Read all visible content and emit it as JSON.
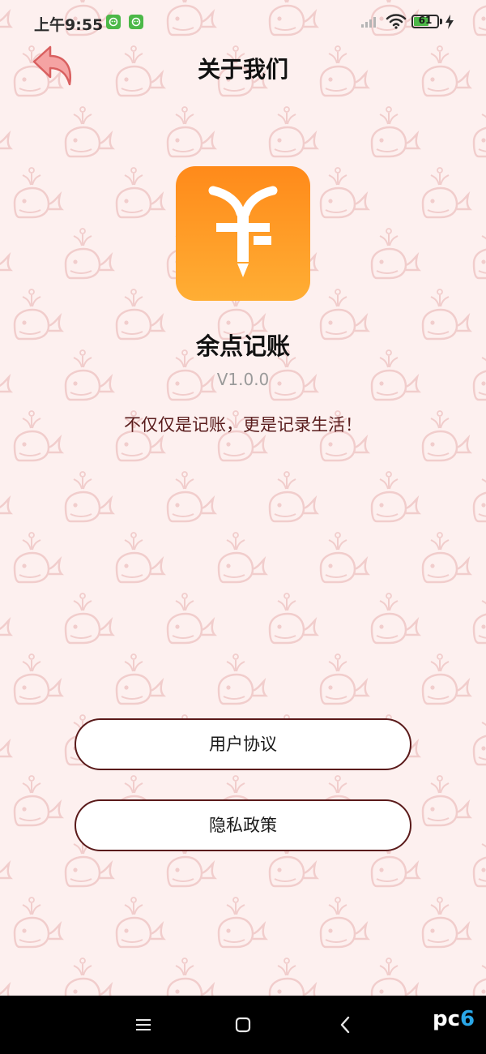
{
  "status_bar": {
    "time": "上午9:55",
    "battery": "61"
  },
  "header": {
    "title": "关于我们",
    "back_icon": "back-arrow-icon"
  },
  "app": {
    "icon": "app-logo-icon",
    "name": "余点记账",
    "version": "V1.0.0",
    "slogan": "不仅仅是记账，更是记录生活！"
  },
  "actions": {
    "user_agreement": "用户协议",
    "privacy_policy": "隐私政策"
  },
  "nav_bar": {
    "menu_icon": "menu-icon",
    "home_icon": "home-icon",
    "back_icon": "back-icon"
  },
  "watermark": {
    "pc": "pc",
    "six": "6"
  },
  "colors": {
    "background": "#FDF0EF",
    "accent_orange": "#FF8A1A",
    "button_border": "#5A1A1A",
    "slogan": "#5A1D1D",
    "back_arrow": "#F08A8A",
    "pattern": "#F3D3D2"
  }
}
